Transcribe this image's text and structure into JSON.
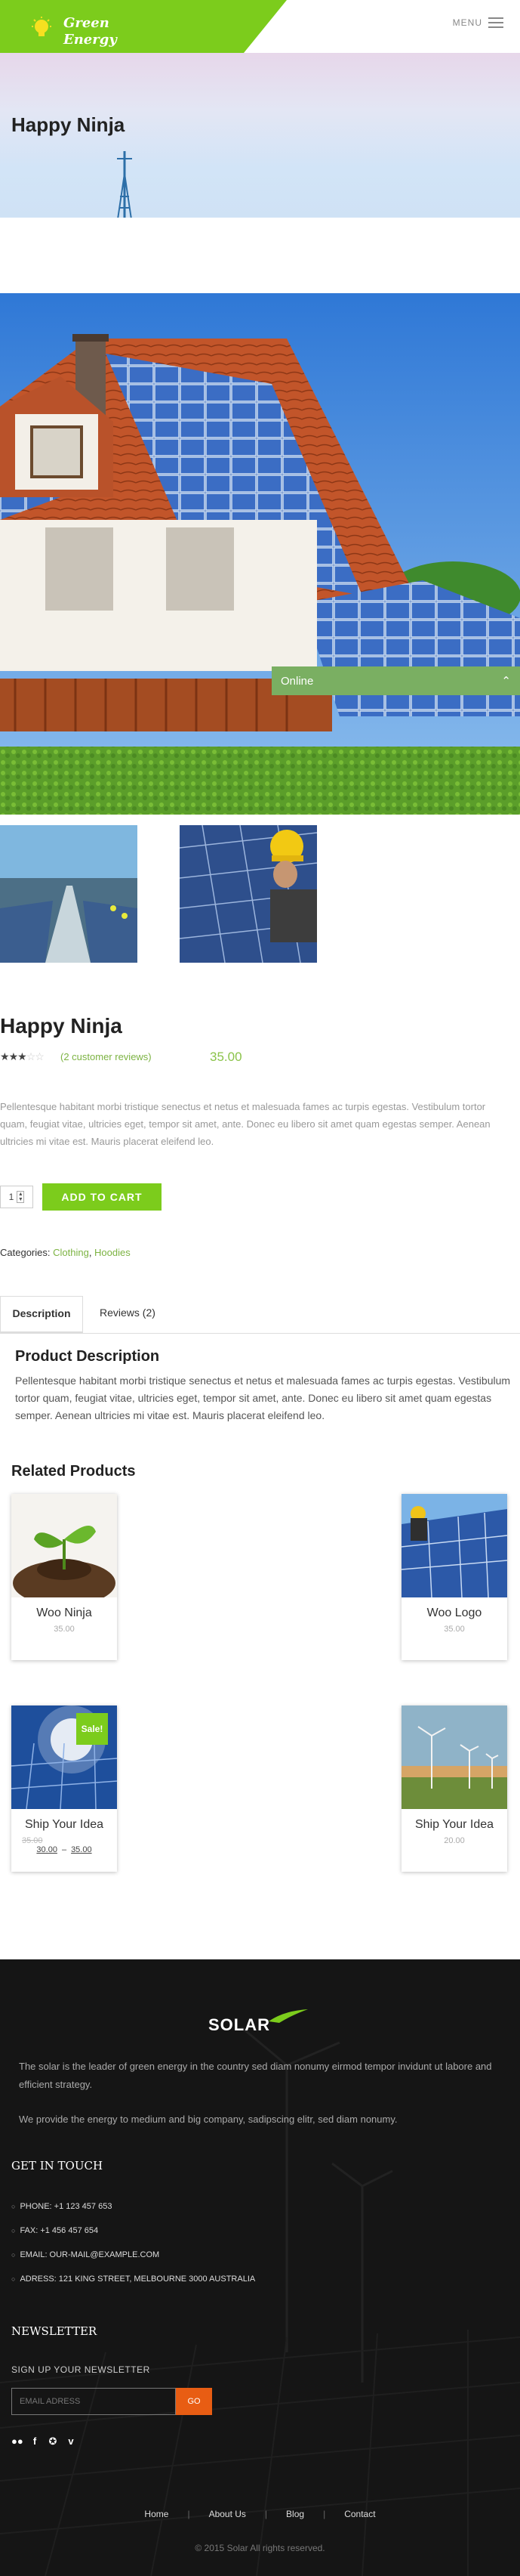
{
  "header": {
    "brand_line1": "Green",
    "brand_line2": "Energy",
    "menu_label": "MENU"
  },
  "hero": {
    "title": "Happy Ninja"
  },
  "chat_widget": {
    "label": "Online",
    "toggle_icon": "chevron-up-icon"
  },
  "product": {
    "title": "Happy Ninja",
    "rating": 3,
    "rating_max": 5,
    "review_link": "(2 customer reviews)",
    "price": "35.00",
    "short_description": "Pellentesque habitant morbi tristique senectus et netus et malesuada fames ac turpis egestas. Vestibulum tortor quam, feugiat vitae, ultricies eget, tempor sit amet, ante. Donec eu libero sit amet quam egestas semper. Aenean ultricies mi vitae est. Mauris placerat eleifend leo.",
    "quantity": "1",
    "add_to_cart": "ADD TO CART",
    "categories_label": "Categories:",
    "categories": [
      "Clothing",
      "Hoodies"
    ],
    "category_separator": ", "
  },
  "tabs": {
    "description": "Description",
    "reviews": "Reviews (2)",
    "panel_title": "Product Description",
    "panel_text": "Pellentesque habitant morbi tristique senectus et netus et malesuada fames ac turpis egestas. Vestibulum tortor quam, feugiat vitae, ultricies eget, tempor sit amet, ante. Donec eu libero sit amet quam egestas semper. Aenean ultricies mi vitae est. Mauris placerat eleifend leo."
  },
  "related": {
    "title": "Related Products",
    "items": [
      {
        "name": "Woo Ninja",
        "price": "35.00"
      },
      {
        "name": "Woo Logo",
        "price": "35.00"
      },
      {
        "name": "Ship Your Idea",
        "old_price": "35.00",
        "price_from": "30.00",
        "price_to": "35.00",
        "range_separator": "–",
        "badge": "Sale!"
      },
      {
        "name": "Ship Your Idea",
        "price": "20.00"
      }
    ]
  },
  "footer": {
    "logo": "SOLAR",
    "about1": "The solar is the leader of green energy in the country sed diam nonumy eirmod tempor invidunt ut labore and efficient strategy.",
    "about2": "We provide the energy to medium and big company, sadipscing elitr, sed diam nonumy.",
    "contact_heading": "GET IN TOUCH",
    "phone": "PHONE: +1 123 457 653",
    "fax": "FAX: +1 456 457 654",
    "email": "EMAIL: OUR-MAIL@EXAMPLE.COM",
    "address": "ADRESS: 121 KING STREET, MELBOURNE 3000 AUSTRALIA",
    "newsletter_heading": "NEWSLETTER",
    "newsletter_label": "SIGN UP YOUR NEWSLETTER",
    "newsletter_placeholder": "EMAIL ADRESS",
    "newsletter_button": "GO",
    "nav": [
      "Home",
      "About Us",
      "Blog",
      "Contact"
    ],
    "copyright": "© 2015 Solar All rights reserved."
  },
  "colors": {
    "brand_green": "#7ccc1c",
    "link_green": "#7cb342",
    "online_green": "#7aaf62",
    "go_orange": "#e85d13",
    "footer_bg": "#151515"
  }
}
